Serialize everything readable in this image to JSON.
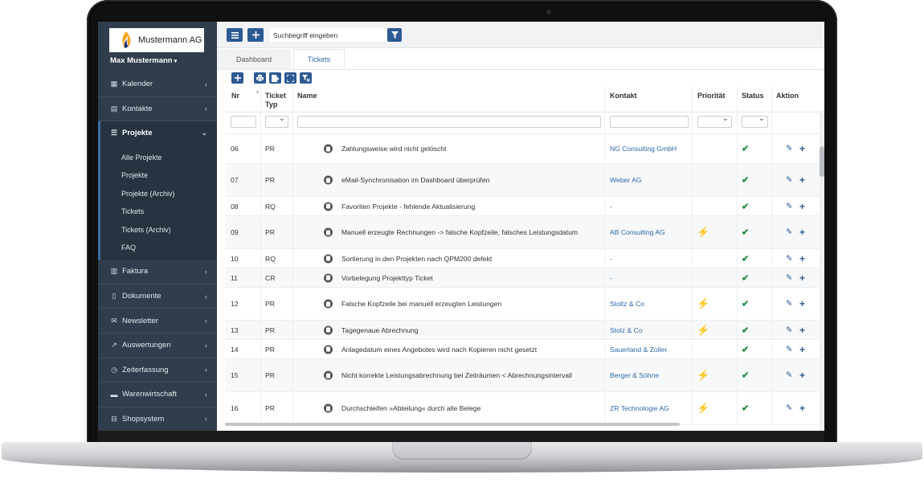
{
  "company": "Mustermann AG",
  "user": {
    "name": "Max Mustermann",
    "caret": "▾"
  },
  "sidebar": {
    "items": [
      {
        "label": "Kalender",
        "icon": "calendar-icon"
      },
      {
        "label": "Kontakte",
        "icon": "contacts-icon"
      },
      {
        "label": "Projekte",
        "icon": "list-icon",
        "active": true,
        "sub": [
          "Alle Projekte",
          "Projekte",
          "Projekte (Archiv)",
          "Tickets",
          "Tickets (Archiv)",
          "FAQ"
        ]
      },
      {
        "label": "Faktura",
        "icon": "invoice-icon"
      },
      {
        "label": "Dokumente",
        "icon": "document-icon"
      },
      {
        "label": "Newsletter",
        "icon": "mail-icon"
      },
      {
        "label": "Auswertungen",
        "icon": "chart-icon"
      },
      {
        "label": "Zeiterfassung",
        "icon": "clock-icon"
      },
      {
        "label": "Warenwirtschaft",
        "icon": "truck-icon"
      },
      {
        "label": "Shopsystem",
        "icon": "cart-icon"
      }
    ]
  },
  "toolbar": {
    "search_placeholder": "Suchbegriff eingeben"
  },
  "tabs": {
    "dashboard": "Dashboard",
    "tickets": "Tickets"
  },
  "table": {
    "headers": {
      "nr": "Nr",
      "typ_line1": "Ticket",
      "typ_line2": "Typ",
      "name": "Name",
      "kontakt": "Kontakt",
      "prioritaet": "Priorität",
      "status": "Status",
      "aktion": "Aktion"
    },
    "rows": [
      {
        "nr": "06",
        "typ": "PR",
        "name": "Zahlungsweise wird nicht gelöscht",
        "kontakt": "NG Consulting GmbH",
        "prio": false,
        "status": "done"
      },
      {
        "nr": "07",
        "typ": "PR",
        "name": "eMail-Synchronisation im Dashboard überprüfen",
        "kontakt": "Weber AG",
        "prio": false,
        "status": "done"
      },
      {
        "nr": "08",
        "typ": "RQ",
        "name": "Favoriten Projekte - fehlende Aktualisierung",
        "kontakt": "-",
        "prio": false,
        "status": "done"
      },
      {
        "nr": "09",
        "typ": "PR",
        "name": "Manuell erzeugte Rechnungen -> falsche Kopfzeile, falsches Leistungsdatum",
        "kontakt": "AB Consulting AG",
        "prio": true,
        "status": "done"
      },
      {
        "nr": "10",
        "typ": "RQ",
        "name": "Sortierung in den Projekten nach QPM200 defekt",
        "kontakt": "-",
        "prio": false,
        "status": "done"
      },
      {
        "nr": "11",
        "typ": "CR",
        "name": "Vorbelegung Projekttyp Ticket",
        "kontakt": "-",
        "prio": false,
        "status": "done"
      },
      {
        "nr": "12",
        "typ": "PR",
        "name": "Falsche Kopfzeile bei manuell erzeugten Leistungen",
        "kontakt": "Stoltz & Co",
        "prio": true,
        "status": "done"
      },
      {
        "nr": "13",
        "typ": "PR",
        "name": "Tagegenaue Abrechnung",
        "kontakt": "Stolz & Co",
        "prio": true,
        "status": "done"
      },
      {
        "nr": "14",
        "typ": "PR",
        "name": "Anlagedatum eines Angebotes wird nach Kopieren nicht gesetzt",
        "kontakt": "Sauerland & Zoller",
        "prio": false,
        "status": "done"
      },
      {
        "nr": "15",
        "typ": "PR",
        "name": "Nicht korrekte Leistungsabrechnung bei Zeiträumen < Abrechnungsintervall",
        "kontakt": "Berger & Söhne",
        "prio": true,
        "status": "done"
      },
      {
        "nr": "16",
        "typ": "PR",
        "name": "Durchschleifen »Abteilung« durch alle Belege",
        "kontakt": "ZR Technologie AG",
        "prio": true,
        "status": "done"
      }
    ]
  },
  "colors": {
    "sidebar": "#2f3d4c",
    "accent": "#2d5a93",
    "link": "#2d6aa6",
    "bolt": "#f0b400",
    "check": "#1e8a3c"
  }
}
